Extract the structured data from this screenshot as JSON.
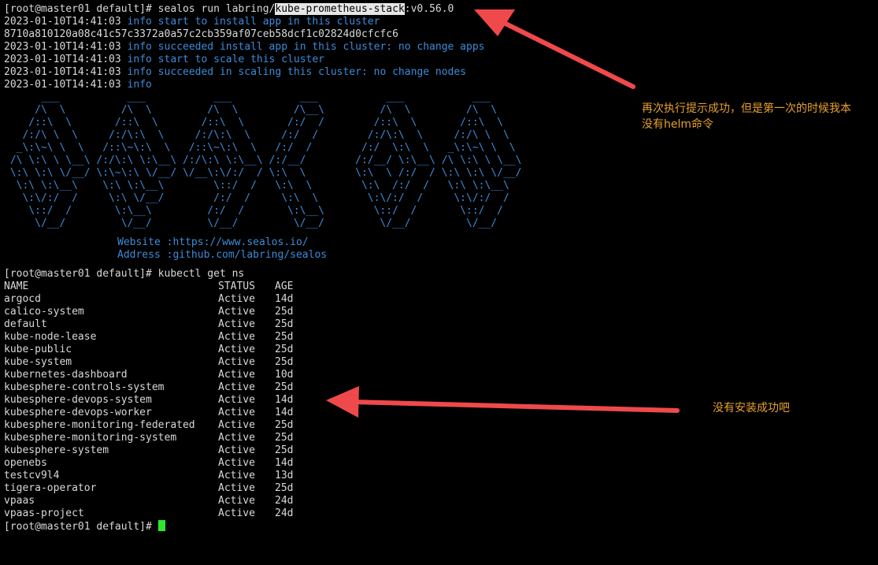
{
  "terminal": {
    "prompt": "[root@master01 default]# ",
    "cmd1_before": "sealos run labring/",
    "cmd1_highlight": "kube-prometheus-stack",
    "cmd1_after": ":v0.56.0",
    "logs": [
      {
        "ts": "2023-01-10T14:41:03 ",
        "msg": "info start to install app in this cluster"
      },
      {
        "ts": "8710a810120a08c41c57c3372a0a57c2cb359af07ceb58dcf1c02824d0cfcfc6",
        "msg": ""
      },
      {
        "ts": "2023-01-10T14:41:03 ",
        "msg": "info succeeded install app in this cluster: no change apps"
      },
      {
        "ts": "2023-01-10T14:41:03 ",
        "msg": "info start to scale this cluster"
      },
      {
        "ts": "2023-01-10T14:41:03 ",
        "msg": "info succeeded in scaling this cluster: no change nodes"
      },
      {
        "ts": "2023-01-10T14:41:03 ",
        "msg": "info"
      }
    ],
    "logo_ascii": "      ___           ___           ___           ___           ___           ___\n     /\\  \\         /\\  \\         /\\  \\         /\\__\\         /\\  \\         /\\  \\\n    /::\\  \\       /::\\  \\       /::\\  \\       /:/  /        /::\\  \\       /::\\  \\\n   /:/\\ \\  \\     /:/\\:\\  \\     /:/\\:\\  \\     /:/  /        /:/\\:\\  \\     /:/\\ \\  \\\n  _\\:\\~\\ \\  \\   /::\\~\\:\\  \\   /::\\~\\:\\  \\   /:/  /        /:/  \\:\\  \\   _\\:\\~\\ \\  \\\n /\\ \\:\\ \\ \\__\\ /:/\\:\\ \\:\\__\\ /:/\\:\\ \\:\\__\\ /:/__/        /:/__/ \\:\\__\\ /\\ \\:\\ \\ \\__\\\n \\:\\ \\:\\ \\/__/ \\:\\~\\:\\ \\/__/ \\/__\\:\\/:/  / \\:\\  \\        \\:\\  \\ /:/  / \\:\\ \\:\\ \\/__/\n  \\:\\ \\:\\__\\    \\:\\ \\:\\__\\        \\::/  /   \\:\\  \\        \\:\\  /:/  /   \\:\\ \\:\\__\\\n   \\:\\/:/  /     \\:\\ \\/__/        /:/  /     \\:\\  \\        \\:\\/:/  /     \\:\\/:/  /\n    \\::/  /       \\:\\__\\         /:/  /       \\:\\__\\        \\::/  /       \\::/  /\n     \\/__/         \\/__/         \\/__/         \\/__/         \\/__/         \\/__/",
    "website": "Website :https://www.sealos.io/",
    "address": "Address :github.com/labring/sealos",
    "cmd2": "kubectl get ns",
    "ns_headers": [
      "NAME",
      "STATUS",
      "AGE"
    ],
    "namespaces": [
      {
        "name": "argocd",
        "status": "Active",
        "age": "14d"
      },
      {
        "name": "calico-system",
        "status": "Active",
        "age": "25d"
      },
      {
        "name": "default",
        "status": "Active",
        "age": "25d"
      },
      {
        "name": "kube-node-lease",
        "status": "Active",
        "age": "25d"
      },
      {
        "name": "kube-public",
        "status": "Active",
        "age": "25d"
      },
      {
        "name": "kube-system",
        "status": "Active",
        "age": "25d"
      },
      {
        "name": "kubernetes-dashboard",
        "status": "Active",
        "age": "10d"
      },
      {
        "name": "kubesphere-controls-system",
        "status": "Active",
        "age": "25d"
      },
      {
        "name": "kubesphere-devops-system",
        "status": "Active",
        "age": "14d"
      },
      {
        "name": "kubesphere-devops-worker",
        "status": "Active",
        "age": "14d"
      },
      {
        "name": "kubesphere-monitoring-federated",
        "status": "Active",
        "age": "25d"
      },
      {
        "name": "kubesphere-monitoring-system",
        "status": "Active",
        "age": "25d"
      },
      {
        "name": "kubesphere-system",
        "status": "Active",
        "age": "25d"
      },
      {
        "name": "openebs",
        "status": "Active",
        "age": "14d"
      },
      {
        "name": "testcv9l4",
        "status": "Active",
        "age": "13d"
      },
      {
        "name": "tigera-operator",
        "status": "Active",
        "age": "25d"
      },
      {
        "name": "vpaas",
        "status": "Active",
        "age": "24d"
      },
      {
        "name": "vpaas-project",
        "status": "Active",
        "age": "24d"
      }
    ]
  },
  "annotations": {
    "note1": "再次执行提示成功，但是第一次的时候我本地没有helm命令",
    "note1_line1": "再次执行提示成功，但是第一次的时候我本",
    "note1_line2": "没有helm命令",
    "note2": "没有安装成功吧",
    "arrow_color": "#f0494b",
    "text_color": "#e8a12a"
  },
  "colors": {
    "background": "#000000",
    "foreground": "#d9d9d9",
    "info_blue": "#3d8bd9",
    "cursor_green": "#2ee62e"
  }
}
